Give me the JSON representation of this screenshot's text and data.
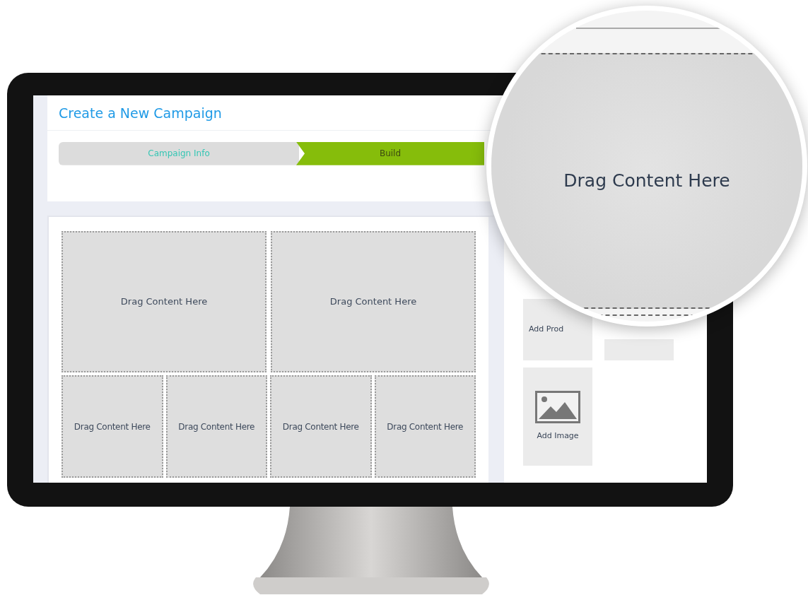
{
  "page": {
    "title": "Create a New Campaign"
  },
  "steps": [
    {
      "label": "Campaign Info",
      "selected": false
    },
    {
      "label": "Build",
      "selected": true
    }
  ],
  "canvas": {
    "rows": [
      [
        "Drag Content Here",
        "Drag Content Here"
      ],
      [
        "Drag Content Here",
        "Drag Content Here",
        "Drag Content Here",
        "Drag Content Here"
      ]
    ]
  },
  "sidebar": {
    "tiles": [
      {
        "kind": "text",
        "label": "Add Prod"
      },
      {
        "kind": "empty"
      },
      {
        "kind": "image",
        "label": "Add Image"
      }
    ]
  },
  "magnifier": {
    "label": "Drag Content Here"
  }
}
